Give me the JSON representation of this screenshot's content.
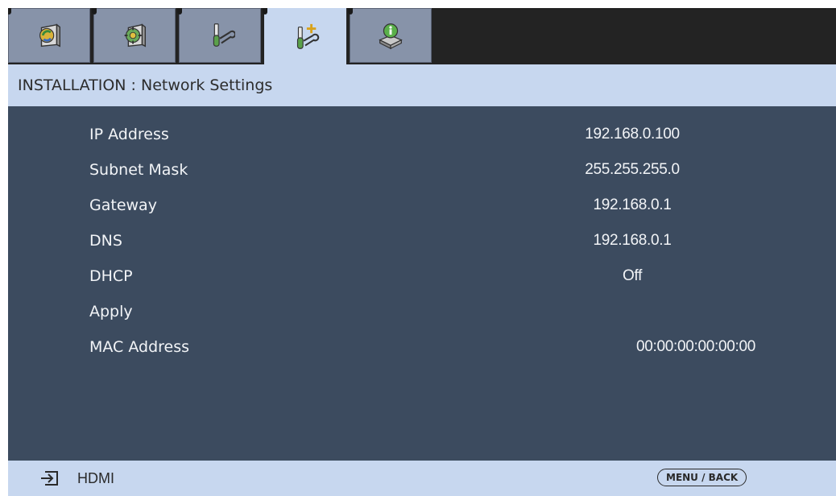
{
  "tabs": [
    {
      "icon": "picture-settings-icon",
      "active": false
    },
    {
      "icon": "advanced-picture-icon",
      "active": false
    },
    {
      "icon": "setup-tools-icon",
      "active": false
    },
    {
      "icon": "installation-tools-icon",
      "active": true
    },
    {
      "icon": "information-icon",
      "active": false
    }
  ],
  "header": {
    "title": "INSTALLATION : Network Settings"
  },
  "settings": [
    {
      "label": "IP Address",
      "value": "192.168.0.100"
    },
    {
      "label": "Subnet Mask",
      "value": "255.255.255.0"
    },
    {
      "label": "Gateway",
      "value": "192.168.0.1"
    },
    {
      "label": "DNS",
      "value": "192.168.0.1"
    },
    {
      "label": "DHCP",
      "value": "Off"
    },
    {
      "label": "Apply",
      "value": ""
    },
    {
      "label": "MAC Address",
      "value": "00:00:00:00:00:00"
    }
  ],
  "status": {
    "source_icon": "input-source-icon",
    "source_label": "HDMI",
    "menu_button": "MENU / BACK"
  },
  "colors": {
    "tab_inactive": "#8793a9",
    "tab_active": "#c7d7ef",
    "content_bg": "#3c4b5f",
    "text_light": "#f2f4f7"
  }
}
